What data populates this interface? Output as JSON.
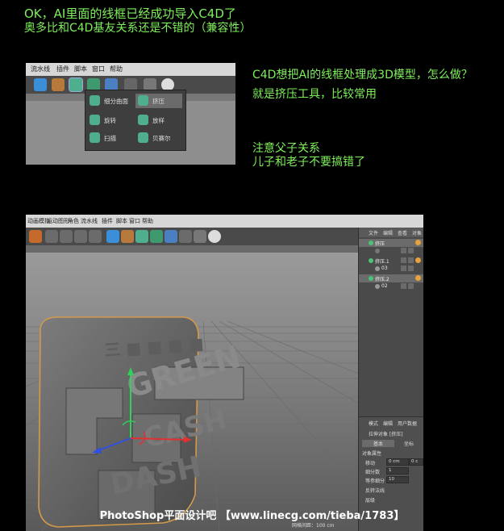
{
  "notes": {
    "line1": "OK，AI里面的线框已经成功导入C4D了",
    "line2": "奥多比和C4D基友关系还是不错的（兼容性）",
    "q1": "C4D想把AI的线框处理成3D模型，怎么做？",
    "q2": "就是挤压工具，比较常用",
    "p1": "注意父子关系",
    "p2": "儿子和老子不要搞错了"
  },
  "shot1": {
    "menu": [
      "流水线",
      "插件",
      "脚本",
      "窗口",
      "帮助"
    ],
    "popup": [
      "细分曲面",
      "挤压",
      "旋转",
      "放样",
      "扫描",
      "贝赛尔"
    ]
  },
  "shot2": {
    "menu": [
      "动画模拟",
      "运动图形",
      "角色",
      "流水线",
      "插件",
      "脚本",
      "窗口",
      "帮助"
    ],
    "om_tabs": [
      "文件",
      "编辑",
      "查看",
      "对象"
    ],
    "objects": [
      {
        "name": "挤压",
        "selected": true
      },
      {
        "name": "",
        "selected": false
      },
      {
        "name": "挤压.1",
        "selected": false
      },
      {
        "name": "03",
        "selected": false
      },
      {
        "name": "挤压.2",
        "selected": true
      },
      {
        "name": "02",
        "selected": false
      }
    ],
    "attr_tabs": [
      "模式",
      "编辑",
      "用户数据"
    ],
    "attr_obj": "拉伸对象 [挤压]",
    "attr_sub": [
      "基本",
      "坐标"
    ],
    "attr_section": "对象属性",
    "attr_rows": [
      {
        "label": "移动",
        "value": "0 cm",
        "value2": "0 c"
      },
      {
        "label": "细分数",
        "value": "1"
      },
      {
        "label": "等参细分",
        "value": "10"
      },
      {
        "label": "反转法线",
        "value": ""
      },
      {
        "label": "层级",
        "value": ""
      }
    ],
    "grid_label": "网格间距：100 cm",
    "scene_text": [
      "GREEN",
      "CASH",
      "DASH"
    ]
  },
  "watermark": "PhotoShop平面设计吧 【www.linecg.com/tieba/1783】",
  "colors": {
    "note": "#7ef05b",
    "c4d_dark": "#4a4a4a",
    "accent_green": "#49c27a"
  }
}
